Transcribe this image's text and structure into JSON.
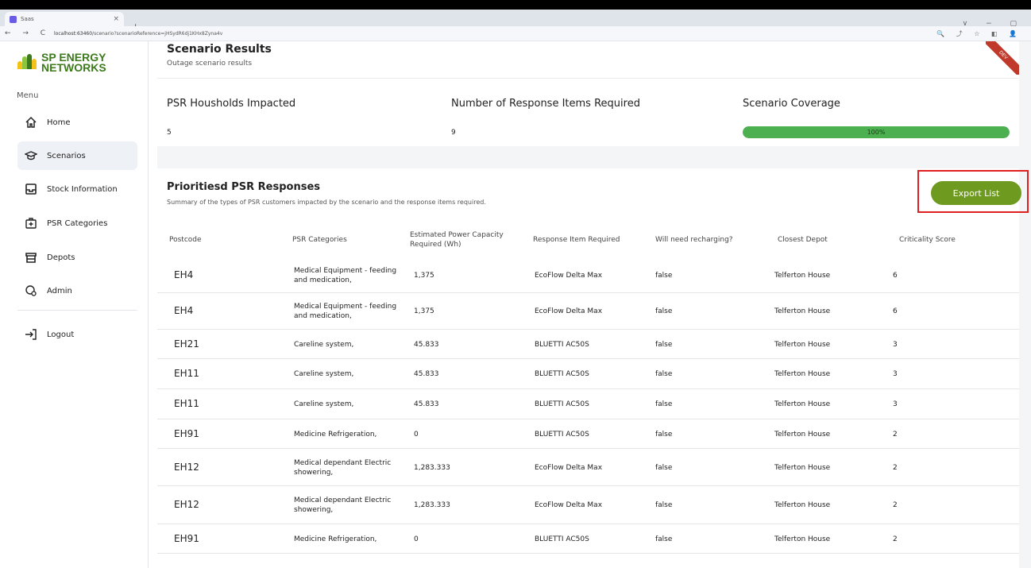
{
  "browser": {
    "tab_title": "Saas",
    "tab_close": "×",
    "new_tab": "+",
    "window_controls": "∨ − ▢",
    "nav": "← → C",
    "url_host": "localhost:63460",
    "url_path": "/scenario?scenarioReference=jHSydR6dj1KHx8Zyna4v",
    "icons": "🔍 ⤴ ☆ ◧ 👤"
  },
  "brand": {
    "name_line1": "SP ENERGY",
    "name_line2": "NETWORKS",
    "colors": {
      "green": "#3c7a1c",
      "yellow": "#f2c21b",
      "lightgreen": "#8cc63f"
    }
  },
  "sidebar": {
    "menu_label": "Menu",
    "items": [
      {
        "label": "Home",
        "icon": "home-icon"
      },
      {
        "label": "Scenarios",
        "icon": "graduation-cap-icon"
      },
      {
        "label": "Stock Information",
        "icon": "inbox-tray-icon"
      },
      {
        "label": "PSR Categories",
        "icon": "medical-bag-icon"
      },
      {
        "label": "Depots",
        "icon": "store-icon"
      },
      {
        "label": "Admin",
        "icon": "user-gear-icon"
      }
    ],
    "logout_label": "Logout"
  },
  "results": {
    "title": "Scenario Results",
    "subtitle": "Outage scenario results",
    "ribbon": "DEV",
    "stats": [
      {
        "label": "PSR Housholds Impacted",
        "value": "5"
      },
      {
        "label": "Number of Response Items Required",
        "value": "9"
      },
      {
        "label": "Scenario Coverage",
        "value": "100%",
        "percent": 100
      }
    ]
  },
  "responses": {
    "title": "Prioritiesd PSR Responses",
    "subtitle": "Summary of the types of PSR customers impacted by the scenario and the response items required.",
    "export_label": "Export List",
    "columns": [
      "Postcode",
      "PSR Categories",
      "Estimated Power Capacity Required (Wh)",
      "Response Item Required",
      "Will need recharging?",
      "Closest Depot",
      "Criticality Score"
    ],
    "rows": [
      {
        "postcode": "EH4",
        "category": "Medical Equipment - feeding and medication,",
        "capacity": "1,375",
        "item": "EcoFlow Delta Max",
        "recharge": "false",
        "depot": "Telferton House",
        "score": "6"
      },
      {
        "postcode": "EH4",
        "category": "Medical Equipment - feeding and medication,",
        "capacity": "1,375",
        "item": "EcoFlow Delta Max",
        "recharge": "false",
        "depot": "Telferton House",
        "score": "6"
      },
      {
        "postcode": "EH21",
        "category": "Careline system,",
        "capacity": "45.833",
        "item": "BLUETTI AC50S",
        "recharge": "false",
        "depot": "Telferton House",
        "score": "3"
      },
      {
        "postcode": "EH11",
        "category": "Careline system,",
        "capacity": "45.833",
        "item": "BLUETTI AC50S",
        "recharge": "false",
        "depot": "Telferton House",
        "score": "3"
      },
      {
        "postcode": "EH11",
        "category": "Careline system,",
        "capacity": "45.833",
        "item": "BLUETTI AC50S",
        "recharge": "false",
        "depot": "Telferton House",
        "score": "3"
      },
      {
        "postcode": "EH91",
        "category": "Medicine Refrigeration,",
        "capacity": "0",
        "item": "BLUETTI AC50S",
        "recharge": "false",
        "depot": "Telferton House",
        "score": "2"
      },
      {
        "postcode": "EH12",
        "category": "Medical dependant Electric showering,",
        "capacity": "1,283.333",
        "item": "EcoFlow Delta Max",
        "recharge": "false",
        "depot": "Telferton House",
        "score": "2"
      },
      {
        "postcode": "EH12",
        "category": "Medical dependant Electric showering,",
        "capacity": "1,283.333",
        "item": "EcoFlow Delta Max",
        "recharge": "false",
        "depot": "Telferton House",
        "score": "2"
      },
      {
        "postcode": "EH91",
        "category": "Medicine Refrigeration,",
        "capacity": "0",
        "item": "BLUETTI AC50S",
        "recharge": "false",
        "depot": "Telferton House",
        "score": "2"
      }
    ]
  }
}
